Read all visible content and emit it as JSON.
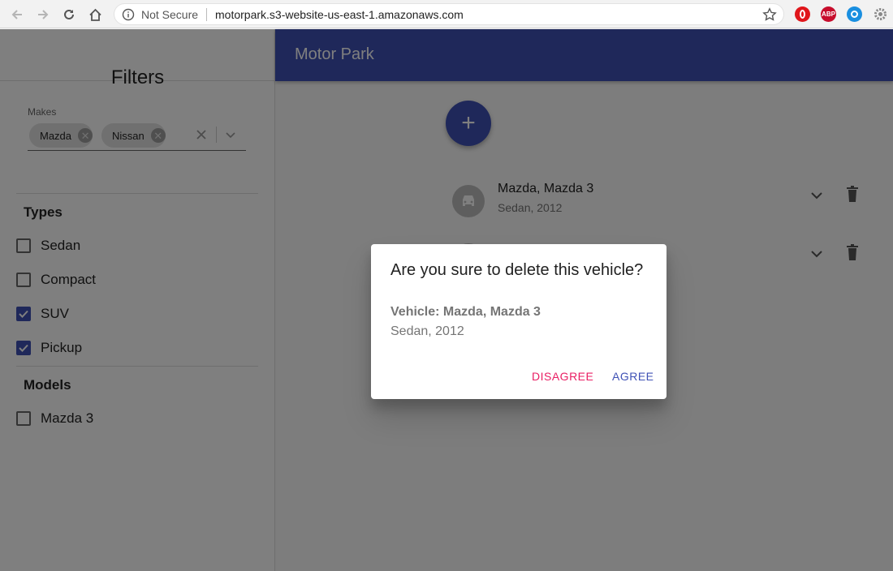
{
  "browser": {
    "security_label": "Not Secure",
    "url": "motorpark.s3-website-us-east-1.amazonaws.com",
    "extensions": [
      {
        "name": "opera-icon",
        "color": "#e0161b"
      },
      {
        "name": "adblock-plus-icon",
        "label": "ABP",
        "color": "#c70d2c"
      },
      {
        "name": "blue-ring-extension-icon",
        "color": "#1a8fe0"
      },
      {
        "name": "settings-gear-icon",
        "color": "#888888"
      }
    ]
  },
  "app": {
    "title": "Motor Park",
    "accent": "#3f51b5",
    "secondary": "#e91e63"
  },
  "filters": {
    "title": "Filters",
    "makes_label": "Makes",
    "selected_makes": [
      "Mazda",
      "Nissan"
    ],
    "types_heading": "Types",
    "types": [
      {
        "label": "Sedan",
        "checked": false
      },
      {
        "label": "Compact",
        "checked": false
      },
      {
        "label": "SUV",
        "checked": true
      },
      {
        "label": "Pickup",
        "checked": true
      }
    ],
    "models_heading": "Models",
    "models": [
      {
        "label": "Mazda 3",
        "checked": false
      }
    ]
  },
  "fab": {
    "icon": "+"
  },
  "vehicles": [
    {
      "title": "Mazda, Mazda 3",
      "subtitle": "Sedan, 2012"
    }
  ],
  "dialog": {
    "title": "Are you sure to delete this vehicle?",
    "vehicle_line": "Vehicle: Mazda, Mazda 3",
    "detail_line": "Sedan, 2012",
    "disagree_label": "DISAGREE",
    "agree_label": "AGREE"
  }
}
